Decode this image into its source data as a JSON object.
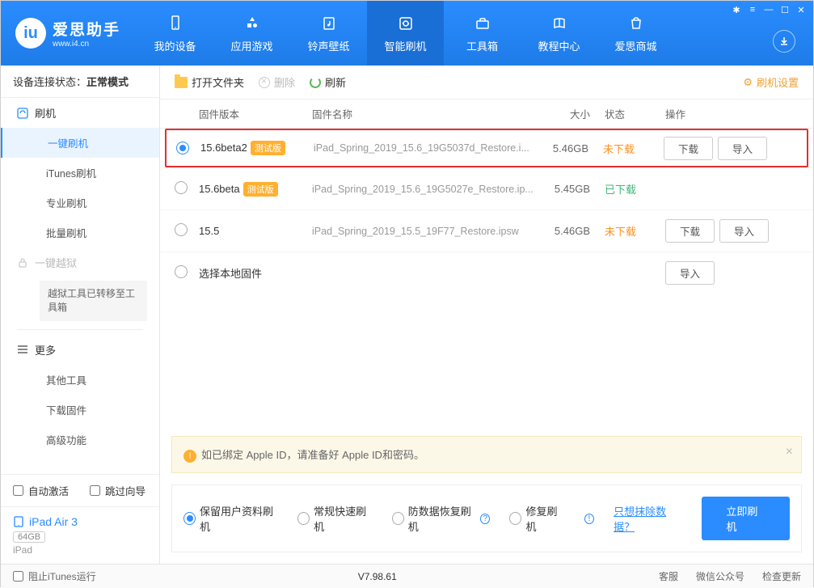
{
  "logo": {
    "title": "爱思助手",
    "site": "www.i4.cn"
  },
  "nav": {
    "items": [
      "我的设备",
      "应用游戏",
      "铃声壁纸",
      "智能刷机",
      "工具箱",
      "教程中心",
      "爱思商城"
    ]
  },
  "sidebar": {
    "status_label": "设备连接状态：",
    "status_value": "正常模式",
    "flash": "刷机",
    "items": [
      "一键刷机",
      "iTunes刷机",
      "专业刷机",
      "批量刷机"
    ],
    "jailbreak": "一键越狱",
    "jb_note": "越狱工具已转移至工具箱",
    "more": "更多",
    "more_items": [
      "其他工具",
      "下载固件",
      "高级功能"
    ],
    "auto_activate": "自动激活",
    "skip_guide": "跳过向导",
    "device_name": "iPad Air 3",
    "device_storage": "64GB",
    "device_type": "iPad"
  },
  "toolbar": {
    "open": "打开文件夹",
    "delete": "删除",
    "refresh": "刷新",
    "settings": "刷机设置"
  },
  "table": {
    "headers": {
      "version": "固件版本",
      "name": "固件名称",
      "size": "大小",
      "status": "状态",
      "ops": "操作"
    },
    "rows": [
      {
        "version": "15.6beta2",
        "beta": "测试版",
        "name": "iPad_Spring_2019_15.6_19G5037d_Restore.i...",
        "size": "5.46GB",
        "status": "未下载",
        "status_class": "stat-orange",
        "ops": [
          "下载",
          "导入"
        ],
        "selected": true,
        "highlight": true
      },
      {
        "version": "15.6beta",
        "beta": "测试版",
        "name": "iPad_Spring_2019_15.6_19G5027e_Restore.ip...",
        "size": "5.45GB",
        "status": "已下载",
        "status_class": "stat-green",
        "ops": [],
        "selected": false
      },
      {
        "version": "15.5",
        "beta": "",
        "name": "iPad_Spring_2019_15.5_19F77_Restore.ipsw",
        "size": "5.46GB",
        "status": "未下载",
        "status_class": "stat-orange",
        "ops": [
          "下载",
          "导入"
        ],
        "selected": false
      },
      {
        "version": "选择本地固件",
        "beta": "",
        "name": "",
        "size": "",
        "status": "",
        "status_class": "",
        "ops": [
          "导入"
        ],
        "selected": false
      }
    ]
  },
  "notice": "如已绑定 Apple ID，请准备好 Apple ID和密码。",
  "options": {
    "items": [
      "保留用户资料刷机",
      "常规快速刷机",
      "防数据恢复刷机",
      "修复刷机"
    ],
    "erase_link": "只想抹除数据？",
    "flash_btn": "立即刷机"
  },
  "footer": {
    "block_itunes": "阻止iTunes运行",
    "version": "V7.98.61",
    "links": [
      "客服",
      "微信公众号",
      "检查更新"
    ]
  }
}
